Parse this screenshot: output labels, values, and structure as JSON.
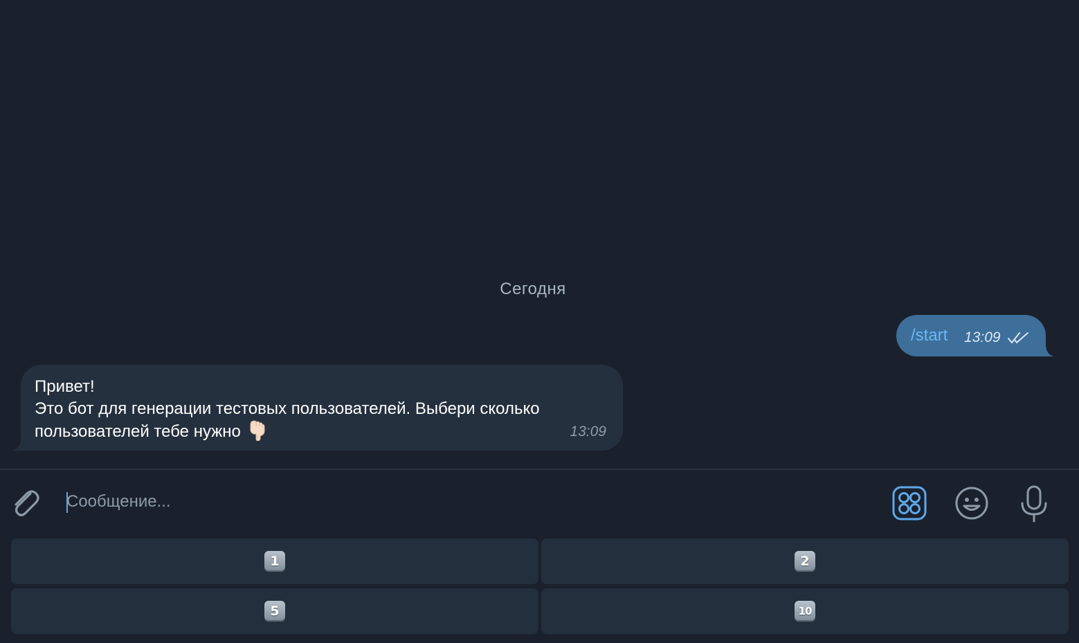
{
  "chat": {
    "date_separator": "Сегодня",
    "outgoing": {
      "text": "/start",
      "time": "13:09",
      "status_icon": "double-check-icon"
    },
    "incoming": {
      "lines": [
        "Привет!",
        "Это бот для генерации тестовых пользователей. Выбери сколько",
        "пользователей тебе нужно"
      ],
      "emoji": "pointing-down-hand-icon",
      "time": "13:09"
    }
  },
  "composer": {
    "placeholder": "Сообщение...",
    "value": "",
    "icons": {
      "attach": "paperclip-icon",
      "bot_keyboard": "bot-keyboard-icon",
      "emoji": "smiley-icon",
      "voice": "microphone-icon"
    },
    "accent_color": "#5fa8e8"
  },
  "reply_keyboard": {
    "buttons": [
      {
        "label": "1"
      },
      {
        "label": "2"
      },
      {
        "label": "5"
      },
      {
        "label": "10"
      }
    ]
  },
  "colors": {
    "background": "#1a212c",
    "incoming_bubble": "#25303e",
    "outgoing_bubble": "#3e6e9a",
    "command_link": "#6ab8f5",
    "keyboard_button": "#242f3d"
  }
}
